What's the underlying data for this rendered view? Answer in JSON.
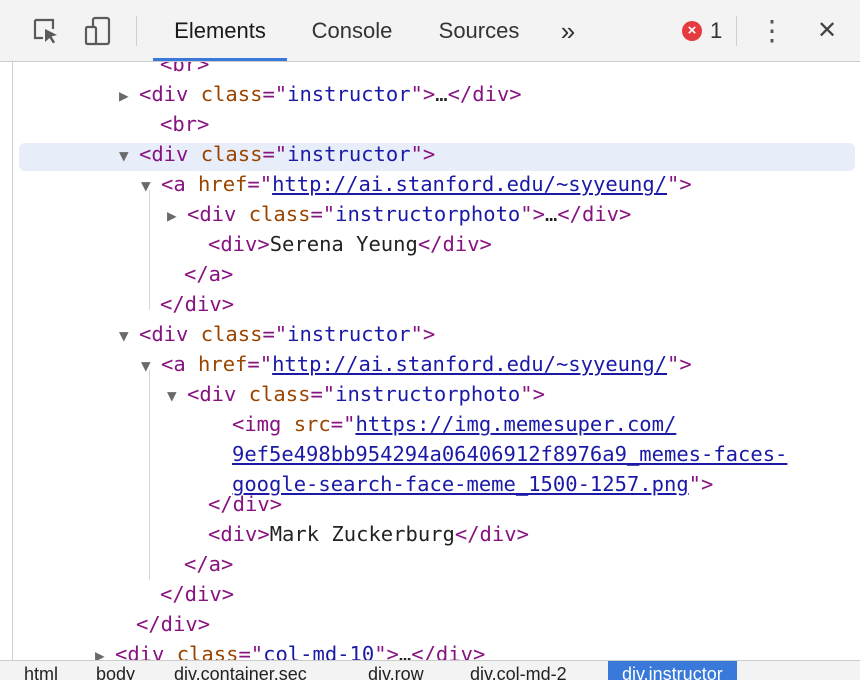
{
  "toolbar": {
    "icons": [
      "inspect-element-icon",
      "device-toolbar-icon"
    ],
    "tabs": [
      "Elements",
      "Console",
      "Sources"
    ],
    "more_tabs": "»",
    "error_count": "1",
    "error_icon": "×",
    "menu_icon": "⋮",
    "close_icon": "✕"
  },
  "tree": {
    "lines": [
      {
        "tri": "",
        "parts": [
          [
            "tag",
            "<br>"
          ]
        ]
      },
      {
        "tri": "▶",
        "parts": [
          [
            "tag",
            "<div "
          ],
          [
            "attr",
            "class"
          ],
          [
            "tag",
            "=\""
          ],
          [
            "val",
            "instructor"
          ],
          [
            "tag",
            "\">"
          ],
          [
            "txt",
            "…"
          ],
          [
            "tag",
            "</div>"
          ]
        ]
      },
      {
        "tri": "",
        "parts": [
          [
            "tag",
            "<br>"
          ]
        ]
      },
      {
        "tri": "▼",
        "parts": [
          [
            "tag",
            "<div "
          ],
          [
            "attr",
            "class"
          ],
          [
            "tag",
            "=\""
          ],
          [
            "val",
            "instructor"
          ],
          [
            "tag",
            "\">"
          ]
        ]
      },
      {
        "tri": "▼",
        "parts": [
          [
            "tag",
            "<a "
          ],
          [
            "attr",
            "href"
          ],
          [
            "tag",
            "=\""
          ],
          [
            "link",
            "http://ai.stanford.edu/~syyeung/"
          ],
          [
            "tag",
            "\">"
          ]
        ]
      },
      {
        "tri": "▶",
        "parts": [
          [
            "tag",
            "<div "
          ],
          [
            "attr",
            "class"
          ],
          [
            "tag",
            "=\""
          ],
          [
            "val",
            "instructorphoto"
          ],
          [
            "tag",
            "\">"
          ],
          [
            "txt",
            "…"
          ],
          [
            "tag",
            "</div>"
          ]
        ]
      },
      {
        "tri": "",
        "parts": [
          [
            "tag",
            "<div>"
          ],
          [
            "txt",
            "Serena Yeung"
          ],
          [
            "tag",
            "</div>"
          ]
        ]
      },
      {
        "tri": "",
        "parts": [
          [
            "tag",
            "</a>"
          ]
        ]
      },
      {
        "tri": "",
        "parts": [
          [
            "tag",
            "</div>"
          ]
        ]
      },
      {
        "tri": "▼",
        "parts": [
          [
            "tag",
            "<div "
          ],
          [
            "attr",
            "class"
          ],
          [
            "tag",
            "=\""
          ],
          [
            "val",
            "instructor"
          ],
          [
            "tag",
            "\">"
          ]
        ]
      },
      {
        "tri": "▼",
        "parts": [
          [
            "tag",
            "<a "
          ],
          [
            "attr",
            "href"
          ],
          [
            "tag",
            "=\""
          ],
          [
            "link",
            "http://ai.stanford.edu/~syyeung/"
          ],
          [
            "tag",
            "\">"
          ]
        ]
      },
      {
        "tri": "▼",
        "parts": [
          [
            "tag",
            "<div "
          ],
          [
            "attr",
            "class"
          ],
          [
            "tag",
            "=\""
          ],
          [
            "val",
            "instructorphoto"
          ],
          [
            "tag",
            "\">"
          ]
        ]
      },
      {
        "tri": "",
        "parts": [
          [
            "tag",
            "<img "
          ],
          [
            "attr",
            "src"
          ],
          [
            "tag",
            "=\""
          ],
          [
            "link",
            "https://img.memesuper.com/"
          ]
        ]
      },
      {
        "tri": "",
        "parts": [
          [
            "link",
            "9ef5e498bb954294a06406912f8976a9_memes-faces-"
          ]
        ]
      },
      {
        "tri": "",
        "parts": [
          [
            "link",
            "google-search-face-meme_1500-1257.png"
          ],
          [
            "tag",
            "\">"
          ]
        ]
      },
      {
        "tri": "",
        "parts": [
          [
            "tag",
            "</div>"
          ]
        ]
      },
      {
        "tri": "",
        "parts": [
          [
            "tag",
            "<div>"
          ],
          [
            "txt",
            "Mark Zuckerburg"
          ],
          [
            "tag",
            "</div>"
          ]
        ]
      },
      {
        "tri": "",
        "parts": [
          [
            "tag",
            "</a>"
          ]
        ]
      },
      {
        "tri": "",
        "parts": [
          [
            "tag",
            "</div>"
          ]
        ]
      },
      {
        "tri": "",
        "parts": [
          [
            "tag",
            "</div>"
          ]
        ]
      },
      {
        "tri": "▶",
        "parts": [
          [
            "tag",
            "<div "
          ],
          [
            "attr",
            "class"
          ],
          [
            "tag",
            "=\""
          ],
          [
            "val",
            "col-md-10"
          ],
          [
            "tag",
            "\">"
          ],
          [
            "txt",
            "…"
          ],
          [
            "tag",
            "</div>"
          ]
        ]
      }
    ]
  },
  "breadcrumbs": [
    "html",
    "body",
    "div.container.sec",
    "div.row",
    "div.col-md-2",
    "div.instructor"
  ]
}
